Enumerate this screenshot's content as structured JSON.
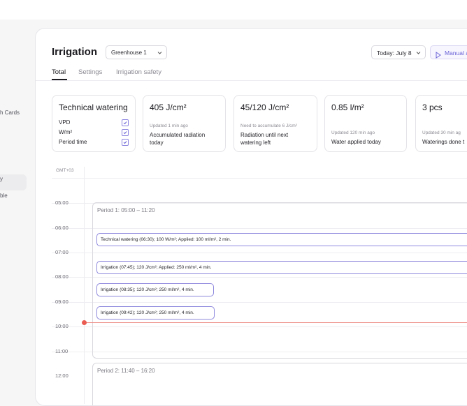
{
  "sidebar": {
    "items": [
      {
        "label": "h Cards"
      },
      {
        "label": ""
      },
      {
        "label": "y"
      },
      {
        "label": "ble"
      }
    ]
  },
  "header": {
    "title": "Irrigation",
    "greenhouse_select": "Greenhouse 1",
    "date_select": "Today: July 8",
    "manual_button": "Manual a"
  },
  "tabs": [
    {
      "label": "Total",
      "active": true
    },
    {
      "label": "Settings",
      "active": false
    },
    {
      "label": "Irrigation safety",
      "active": false
    }
  ],
  "cards": {
    "technical": {
      "title": "Technical watering",
      "rows": [
        {
          "label": "VPD",
          "checked": true
        },
        {
          "label": "W/m²",
          "checked": true
        },
        {
          "label": "Period time",
          "checked": true
        }
      ]
    },
    "radiation": {
      "value": "405 J/cm²",
      "small": "Updated 1 min ago",
      "desc": "Accumulated radiation today"
    },
    "accumulate": {
      "value": "45/120 J/cm²",
      "small": "Need to accumulate 6 J/cm²",
      "desc": "Radiation until next watering left"
    },
    "water": {
      "value": "0.85 l/m²",
      "small": "Updated 120 min ago",
      "desc": "Water applied today"
    },
    "count": {
      "value": "3 pcs",
      "small": "Updated 30 min ag",
      "desc": "Waterings done t"
    }
  },
  "calendar": {
    "timezone": "GMT+03",
    "hours": [
      "05:00",
      "06:00",
      "07:00",
      "08:00",
      "09:00",
      "10:00",
      "11:00",
      "12:00"
    ],
    "periods": [
      {
        "label": "Period 1: 05:00 – 11:20"
      },
      {
        "label": "Period 2: 11:40 – 16:20"
      }
    ],
    "events": [
      {
        "text": "Technical watering (06:30); 100 W/m²; Applied: 100 ml/m², 2 min."
      },
      {
        "text": "Irrigation (07:45); 120 J/cm²; Applied: 250 ml/m², 4 min."
      },
      {
        "text": "Irrigation (08:35); 120 J/cm²; 250 ml/m², 4 min."
      },
      {
        "text": "Irrigation (09:42); 120 J/cm²; 250 ml/m², 4 min."
      }
    ]
  },
  "colors": {
    "accent": "#6b63d6",
    "event_border": "#8e88dd",
    "now_indicator": "#ea5b52"
  }
}
